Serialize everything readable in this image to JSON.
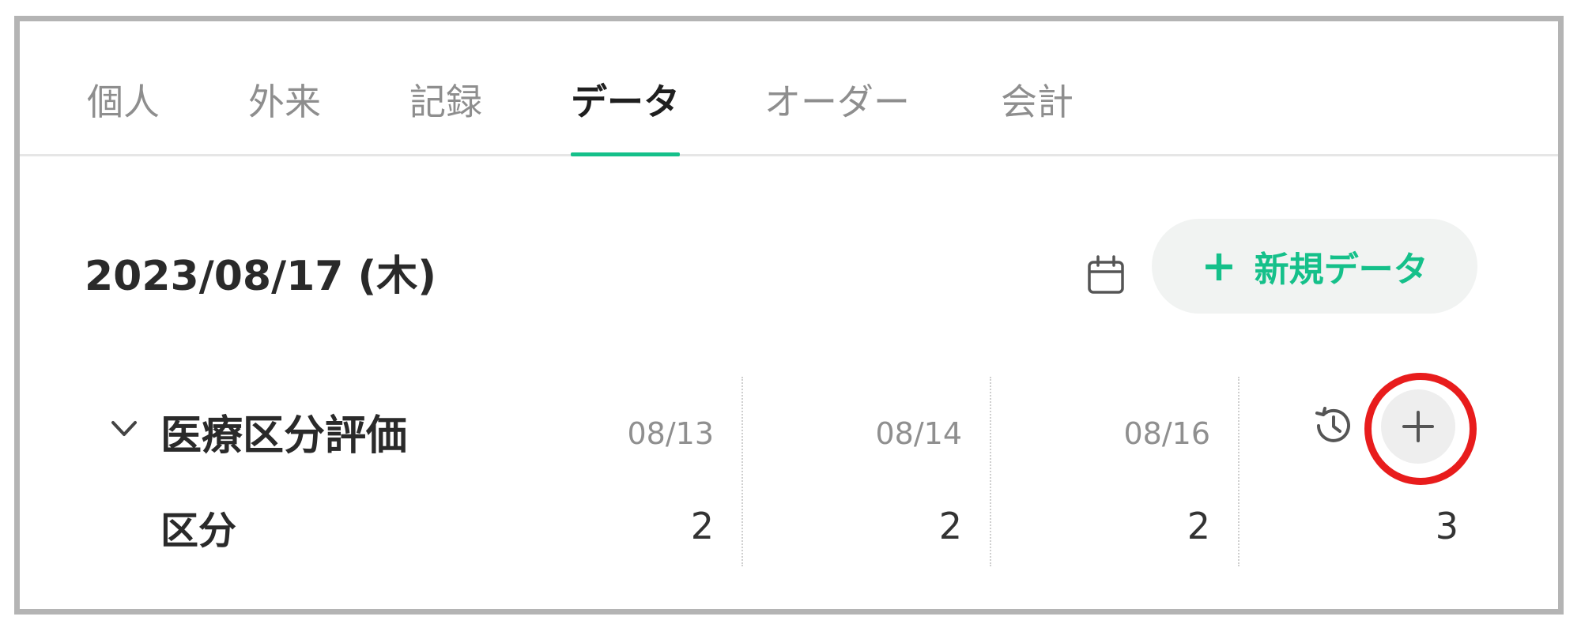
{
  "tabs": [
    {
      "label": "個人"
    },
    {
      "label": "外来"
    },
    {
      "label": "記録"
    },
    {
      "label": "データ",
      "active": true
    },
    {
      "label": "オーダー"
    },
    {
      "label": "会計"
    }
  ],
  "date": {
    "label": "2023/08/17 (木)"
  },
  "actions": {
    "new_data_label": "新規データ",
    "new_data_icon": "plus-icon",
    "calendar_icon": "calendar-icon"
  },
  "section": {
    "title": "医療区分評価",
    "columns": [
      "08/13",
      "08/14",
      "08/16"
    ],
    "rows": [
      {
        "label": "区分",
        "values": [
          "2",
          "2",
          "2",
          "3"
        ]
      }
    ],
    "history_icon": "history-icon",
    "add_icon": "plus-icon"
  },
  "colors": {
    "accent": "#15c08a",
    "highlight": "#e81c1c"
  }
}
